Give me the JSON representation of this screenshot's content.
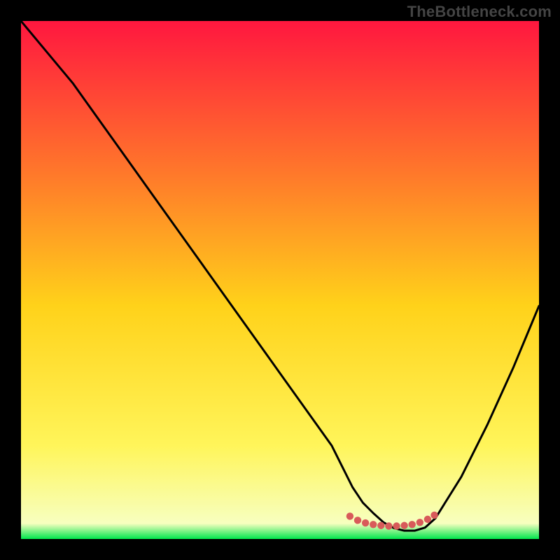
{
  "watermark": "TheBottleneck.com",
  "colors": {
    "gradient_top": "#ff173f",
    "gradient_mid_upper": "#ff7a2a",
    "gradient_mid": "#ffd21a",
    "gradient_lower": "#fff55a",
    "gradient_bottom": "#00e64d",
    "curve": "#000000",
    "marker": "#d85a5a",
    "background": "#000000"
  },
  "chart_data": {
    "type": "line",
    "title": "",
    "xlabel": "",
    "ylabel": "",
    "xlim": [
      0,
      100
    ],
    "ylim": [
      0,
      100
    ],
    "series": [
      {
        "name": "bottleneck-curve",
        "x": [
          0,
          5,
          10,
          15,
          20,
          25,
          30,
          35,
          40,
          45,
          50,
          55,
          60,
          62,
          64,
          66,
          68,
          70,
          72,
          74,
          76,
          78,
          80,
          85,
          90,
          95,
          100
        ],
        "values": [
          100,
          94,
          88,
          81,
          74,
          67,
          60,
          53,
          46,
          39,
          32,
          25,
          18,
          14,
          10,
          7,
          5,
          3.2,
          2.1,
          1.6,
          1.6,
          2.2,
          4,
          12,
          22,
          33,
          45
        ]
      },
      {
        "name": "optimal-region-markers",
        "x": [
          63.5,
          65,
          66.5,
          68,
          69.5,
          71,
          72.5,
          74,
          75.5,
          77,
          78.5,
          79.8
        ],
        "values": [
          4.4,
          3.6,
          3.1,
          2.8,
          2.6,
          2.5,
          2.5,
          2.6,
          2.8,
          3.2,
          3.8,
          4.6
        ]
      }
    ],
    "annotations": []
  }
}
